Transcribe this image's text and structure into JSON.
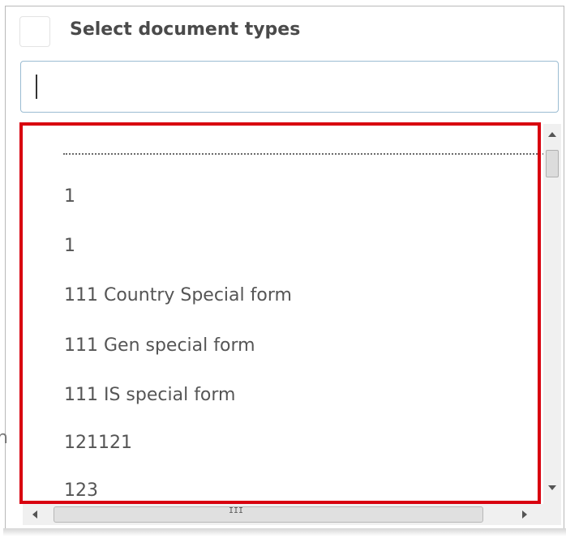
{
  "header": {
    "title": "Select document types"
  },
  "search": {
    "value": "",
    "placeholder": ""
  },
  "left_fragment": "n",
  "list": {
    "items": [
      "1",
      "1",
      "111 Country Special form",
      "111 Gen special form",
      "111 IS special form",
      "121121",
      "123"
    ]
  },
  "hscroll": {
    "grip": "III"
  },
  "colors": {
    "highlight_border": "#d8000f",
    "input_border": "#9bbcd2",
    "text": "#555555"
  },
  "icons": {
    "scroll_up": "arrow-up-icon",
    "scroll_down": "arrow-down-icon",
    "scroll_left": "arrow-left-icon",
    "scroll_right": "arrow-right-icon"
  }
}
